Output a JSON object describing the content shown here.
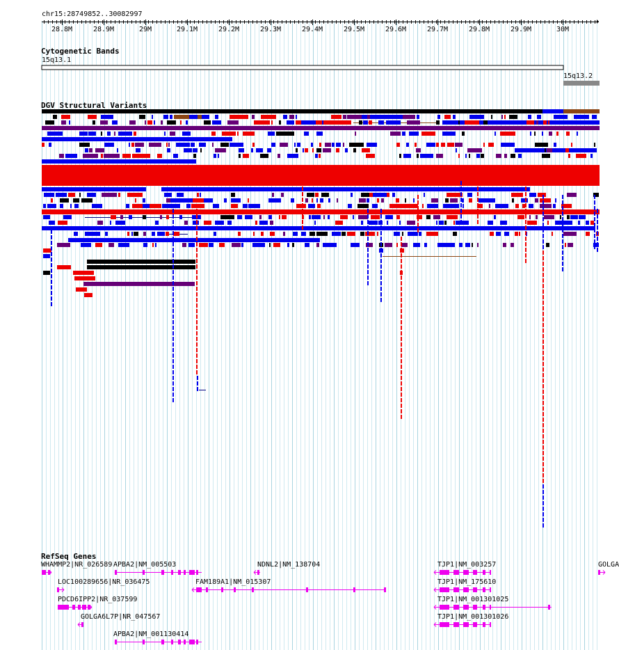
{
  "location_label": "chr15:28749852..30082997",
  "ruler": {
    "ticks": [
      "28.8M",
      "28.9M",
      "29M",
      "29.1M",
      "29.2M",
      "29.3M",
      "29.4M",
      "29.5M",
      "29.6M",
      "29.7M",
      "29.8M",
      "29.9M",
      "30M"
    ]
  },
  "tracks": {
    "cytoband": {
      "title": "Cytogenetic Bands",
      "bands": [
        {
          "name": "15q13.1",
          "color": "#ffffff"
        },
        {
          "name": "15q13.2",
          "color": "#888888"
        }
      ]
    },
    "dgv": {
      "title": "DGV Structural Variants",
      "colors": {
        "gain": "#0000ee",
        "loss": "#ee0000",
        "complex": "#660077",
        "inversion": "#000000",
        "other": "#8b4513"
      }
    },
    "refseq": {
      "title": "RefSeq Genes",
      "color": "#ee00ee",
      "genes": [
        {
          "label": "WHAMMP2|NR_026589"
        },
        {
          "label": "APBA2|NM_005503"
        },
        {
          "label": "LOC100289656|NR_036475"
        },
        {
          "label": "PDCD6IPP2|NR_037599"
        },
        {
          "label": "GOLGA6L7P|NR_047567"
        },
        {
          "label": "APBA2|NM_001130414"
        },
        {
          "label": "FAM189A1|NM_015307"
        },
        {
          "label": "NDNL2|NM_138704"
        },
        {
          "label": "TJP1|NM_003257"
        },
        {
          "label": "TJP1|NM_175610"
        },
        {
          "label": "TJP1|NM_001301025"
        },
        {
          "label": "TJP1|NM_001301026"
        },
        {
          "label": "GOLGA"
        }
      ]
    }
  }
}
